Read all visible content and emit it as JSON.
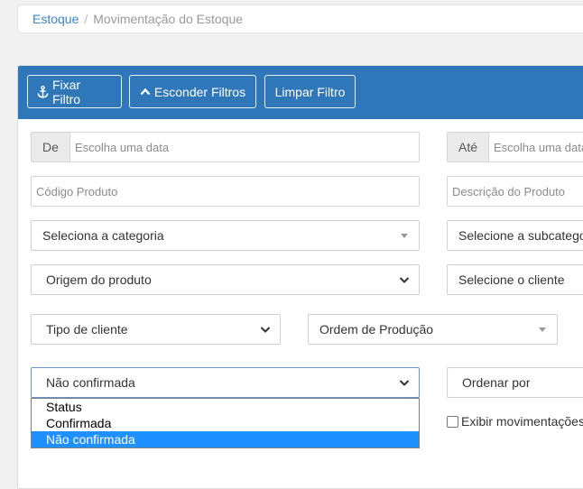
{
  "breadcrumb": {
    "root": "Estoque",
    "separator": "/",
    "current": "Movimentação do Estoque"
  },
  "toolbar": {
    "fix_filter": "Fixar Filtro",
    "hide_filters": "Esconder Filtros",
    "clear_filter": "Limpar Filtro"
  },
  "filters": {
    "from_addon": "De",
    "from_placeholder": "Escolha uma data",
    "to_addon": "Até",
    "to_placeholder": "Escolha uma data",
    "product_code_placeholder": "Código Produto",
    "product_desc_placeholder": "Descrição do Produto",
    "category": "Seleciona a categoria",
    "subcategory": "Selecione a subcategoria",
    "origin": "Origem do produto",
    "client": "Selecione o cliente",
    "client_type": "Tipo de cliente",
    "production_order": "Ordem de Produção",
    "status_selected": "Não confirmada",
    "status_options": [
      "Status",
      "Confirmada",
      "Não confirmada"
    ],
    "order_by": "Ordenar por",
    "show_movements": "Exibir movimentações"
  },
  "colors": {
    "header_bg": "#2f77b9",
    "link": "#3a86c8",
    "selected_option": "#1e90ff"
  }
}
